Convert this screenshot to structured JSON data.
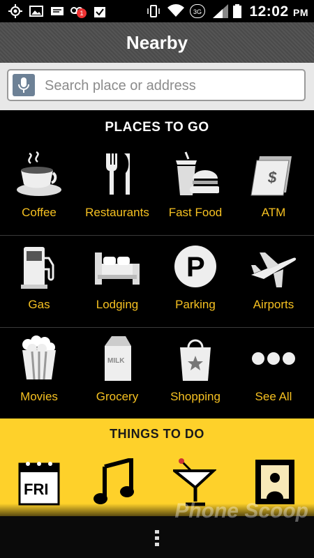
{
  "status_bar": {
    "time": "12:02",
    "ampm": "PM",
    "network": "3G",
    "notification_count": "1",
    "icons": [
      "gps-icon",
      "image-icon",
      "email-icon",
      "voicemail-icon",
      "checkmark-bag-icon",
      "vibrate-icon",
      "wifi-icon",
      "network-3g-icon",
      "signal-icon",
      "battery-icon"
    ]
  },
  "header": {
    "title": "Nearby"
  },
  "search": {
    "placeholder": "Search place or address",
    "mic_icon": "microphone-icon"
  },
  "places": {
    "title": "PLACES TO GO",
    "items": [
      {
        "label": "Coffee",
        "icon": "coffee-cup-icon"
      },
      {
        "label": "Restaurants",
        "icon": "fork-knife-icon"
      },
      {
        "label": "Fast Food",
        "icon": "fast-food-icon"
      },
      {
        "label": "ATM",
        "icon": "atm-cash-icon"
      },
      {
        "label": "Gas",
        "icon": "gas-pump-icon"
      },
      {
        "label": "Lodging",
        "icon": "bed-icon"
      },
      {
        "label": "Parking",
        "icon": "parking-icon"
      },
      {
        "label": "Airports",
        "icon": "airplane-icon"
      },
      {
        "label": "Movies",
        "icon": "popcorn-icon"
      },
      {
        "label": "Grocery",
        "icon": "milk-carton-icon"
      },
      {
        "label": "Shopping",
        "icon": "shopping-bag-icon"
      },
      {
        "label": "See All",
        "icon": "more-dots-icon"
      }
    ]
  },
  "things": {
    "title": "THINGS TO DO",
    "items": [
      {
        "label": "FRI",
        "icon": "calendar-icon"
      },
      {
        "label": "",
        "icon": "music-note-icon"
      },
      {
        "label": "",
        "icon": "cocktail-icon"
      },
      {
        "label": "",
        "icon": "art-painting-icon"
      }
    ]
  },
  "icon_labels": {
    "milk": "MILK"
  },
  "watermark": "Phone Scoop",
  "colors": {
    "accent_yellow": "#fed12a",
    "label_yellow": "#f6c121",
    "background": "#000000"
  }
}
